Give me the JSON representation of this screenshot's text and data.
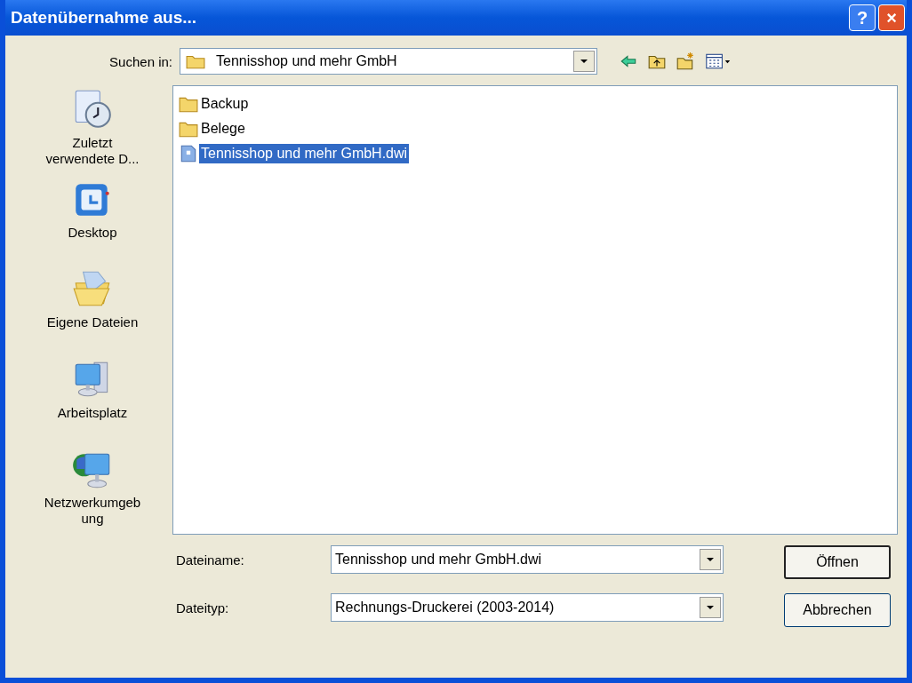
{
  "window": {
    "title": "Datenübernahme aus...",
    "buttons": [
      {
        "kind": "help",
        "label": "?"
      },
      {
        "kind": "close",
        "label": "×"
      }
    ]
  },
  "look_in": {
    "label": "Suchen in:",
    "value": "Tennisshop und mehr GmbH"
  },
  "places": [
    {
      "kind": "recent",
      "label": "Zuletzt verwendete D..."
    },
    {
      "kind": "desktop",
      "label": "Desktop"
    },
    {
      "kind": "documents",
      "label": "Eigene Dateien"
    },
    {
      "kind": "computer",
      "label": "Arbeitsplatz"
    },
    {
      "kind": "network",
      "label": "Netzwerkumgeb ung"
    }
  ],
  "files": [
    {
      "kind": "folder",
      "name": "Backup",
      "selected": false
    },
    {
      "kind": "folder",
      "name": "Belege",
      "selected": false
    },
    {
      "kind": "file",
      "name": "Tennisshop und mehr GmbH.dwi",
      "selected": true
    }
  ],
  "filename": {
    "label": "Dateiname:",
    "value": "Tennisshop und mehr GmbH.dwi"
  },
  "filetype": {
    "label": "Dateityp:",
    "value": "Rechnungs-Druckerei (2003-2014)"
  },
  "buttons": [
    {
      "label": "Öffnen",
      "default": true
    },
    {
      "label": "Abbrechen",
      "default": false
    }
  ]
}
